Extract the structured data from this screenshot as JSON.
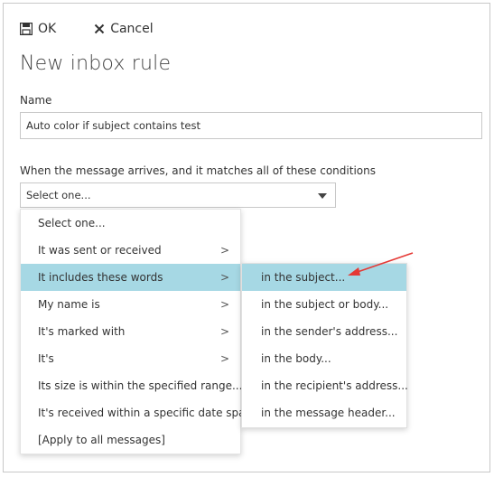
{
  "toolbar": {
    "ok_label": "OK",
    "cancel_label": "Cancel"
  },
  "title": "New inbox rule",
  "name_label": "Name",
  "name_value": "Auto color if subject contains test",
  "condition_label": "When the message arrives, and it matches all of these conditions",
  "condition_select": "Select one...",
  "menu": {
    "items": [
      {
        "label": "Select one...",
        "has_submenu": false
      },
      {
        "label": "It was sent or received",
        "has_submenu": true
      },
      {
        "label": "It includes these words",
        "has_submenu": true,
        "selected": true
      },
      {
        "label": "My name is",
        "has_submenu": true
      },
      {
        "label": "It's marked with",
        "has_submenu": true
      },
      {
        "label": "It's",
        "has_submenu": true
      },
      {
        "label": "Its size is within the specified range...",
        "has_submenu": false
      },
      {
        "label": "It's received within a specific date span...",
        "has_submenu": false
      },
      {
        "label": "[Apply to all messages]",
        "has_submenu": false
      }
    ],
    "chevron": ">"
  },
  "submenu": {
    "items": [
      {
        "label": "in the subject...",
        "selected": true
      },
      {
        "label": "in the subject or body..."
      },
      {
        "label": "in the sender's address..."
      },
      {
        "label": "in the body..."
      },
      {
        "label": "in the recipient's address..."
      },
      {
        "label": "in the message header..."
      }
    ]
  },
  "colors": {
    "highlight": "#a6d8e4",
    "annotation_arrow": "#e53935"
  }
}
